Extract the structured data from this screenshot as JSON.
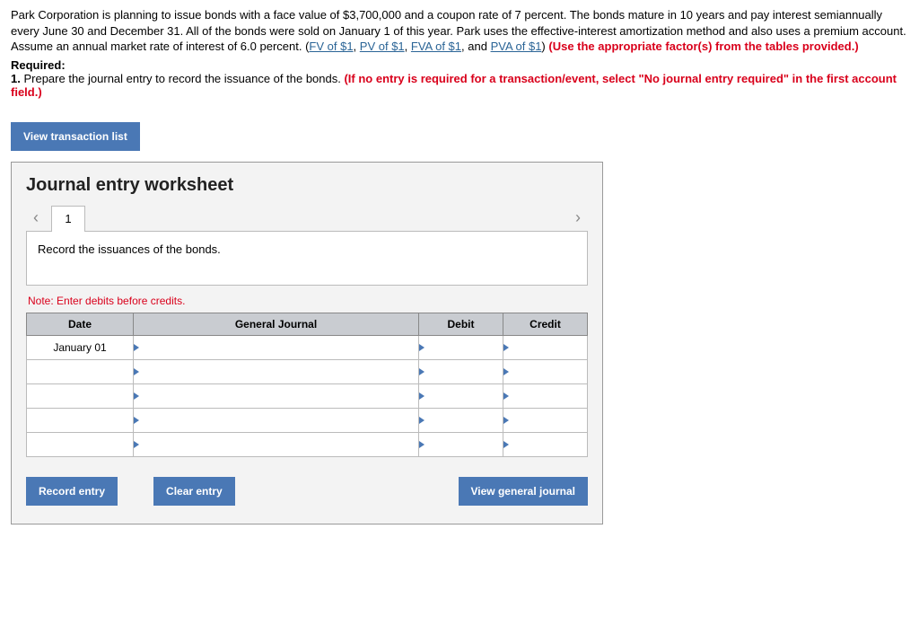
{
  "problem": {
    "intro_a": "Park Corporation is planning to issue bonds with a face value of $3,700,000 and a coupon rate of 7 percent. The bonds mature in 10 years and pay interest semiannually every June 30 and December 31. All of the bonds were sold on January 1 of this year. Park uses the effective-interest amortization method and also uses a premium account. Assume an annual market rate of interest of 6.0 percent. (",
    "fv": "FV of $1",
    "sep": ", ",
    "pv": "PV of $1",
    "fva": "FVA of $1",
    "and": ", and ",
    "pva": "PVA of $1",
    "close_paren": ") ",
    "use_factors": "(Use the appropriate factor(s) from the tables provided.)",
    "required_label": "Required:",
    "req1_a": "1. ",
    "req1_b": "Prepare the journal entry to record the issuance of the bonds. ",
    "req1_red": "(If no entry is required for a transaction/event, select \"No journal entry required\" in the first account field.)"
  },
  "buttons": {
    "view_transaction_list": "View transaction list",
    "record_entry": "Record entry",
    "clear_entry": "Clear entry",
    "view_general_journal": "View general journal"
  },
  "worksheet": {
    "title": "Journal entry worksheet",
    "step": "1",
    "instruction": "Record the issuances of the bonds.",
    "note": "Note: Enter debits before credits.",
    "headers": {
      "date": "Date",
      "general_journal": "General Journal",
      "debit": "Debit",
      "credit": "Credit"
    },
    "rows": [
      {
        "date": "January 01"
      },
      {
        "date": ""
      },
      {
        "date": ""
      },
      {
        "date": ""
      },
      {
        "date": ""
      }
    ]
  }
}
